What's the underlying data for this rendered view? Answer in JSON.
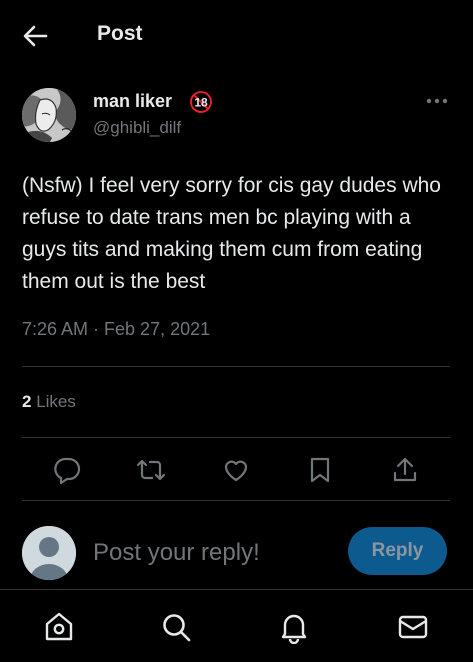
{
  "header": {
    "title": "Post"
  },
  "post": {
    "author_name": "man liker",
    "badge_text": "18",
    "handle": "@ghibli_dilf",
    "text": "(Nsfw) I feel very sorry for cis gay dudes who refuse to date trans men bc playing with a guys tits and making them cum from eating them out is the best",
    "timestamp": "7:26 AM · Feb 27, 2021",
    "likes_count": "2",
    "likes_label": "Likes"
  },
  "reply": {
    "placeholder": "Post your reply!",
    "button_label": "Reply"
  },
  "icons": [
    "back-arrow-icon",
    "no-under-18-icon",
    "more-icon",
    "reply-icon",
    "repost-icon",
    "like-icon",
    "bookmark-icon",
    "share-icon",
    "default-avatar-icon",
    "home-icon",
    "search-icon",
    "notifications-icon",
    "messages-icon"
  ],
  "colors": {
    "background": "#000000",
    "text": "#e7e9ea",
    "secondary": "#71767b",
    "divider": "#2f3336",
    "reply_button": "#0d5a8f",
    "badge_red": "#f4212e"
  }
}
